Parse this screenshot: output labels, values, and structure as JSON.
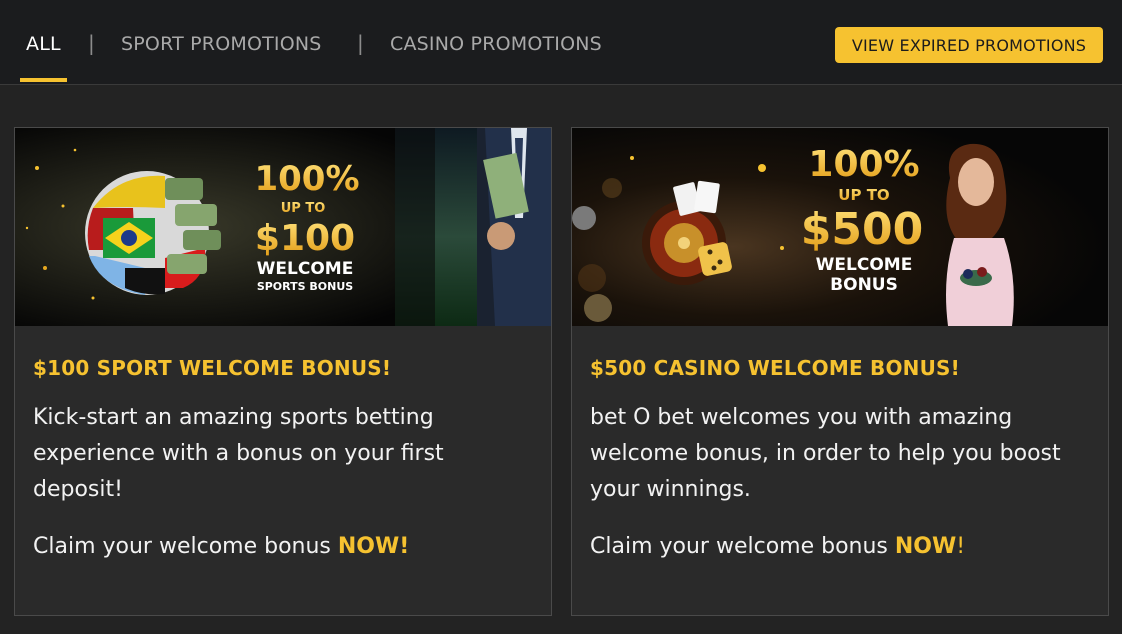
{
  "tabs": {
    "all": "ALL",
    "sport": "SPORT PROMOTIONS",
    "casino": "CASINO PROMOTIONS",
    "separator": "|"
  },
  "expired_button": "VIEW EXPIRED PROMOTIONS",
  "cards": [
    {
      "banner": {
        "percent": "100%",
        "up_to": "UP TO",
        "amount": "$100",
        "welcome": "WELCOME",
        "sub": "SPORTS BONUS"
      },
      "title": "$100 SPORT WELCOME BONUS!",
      "description": "Kick-start an amazing sports betting experience with a bonus on your first deposit!",
      "claim_text": "Claim your welcome bonus ",
      "claim_now": "NOW!",
      "claim_suffix": ""
    },
    {
      "banner": {
        "percent": "100%",
        "up_to": "UP TO",
        "amount": "$500",
        "welcome": "WELCOME",
        "sub": "BONUS"
      },
      "title": "$500 CASINO WELCOME BONUS!",
      "description": "bet O bet welcomes you with amazing welcome bonus, in order to help you boost your winnings.",
      "claim_text": "Claim your welcome bonus ",
      "claim_now": "NOW",
      "claim_suffix": "!"
    }
  ],
  "colors": {
    "accent": "#f6c230",
    "background": "#232323",
    "topbar": "#1b1c1e",
    "card": "#2a2a2a"
  }
}
